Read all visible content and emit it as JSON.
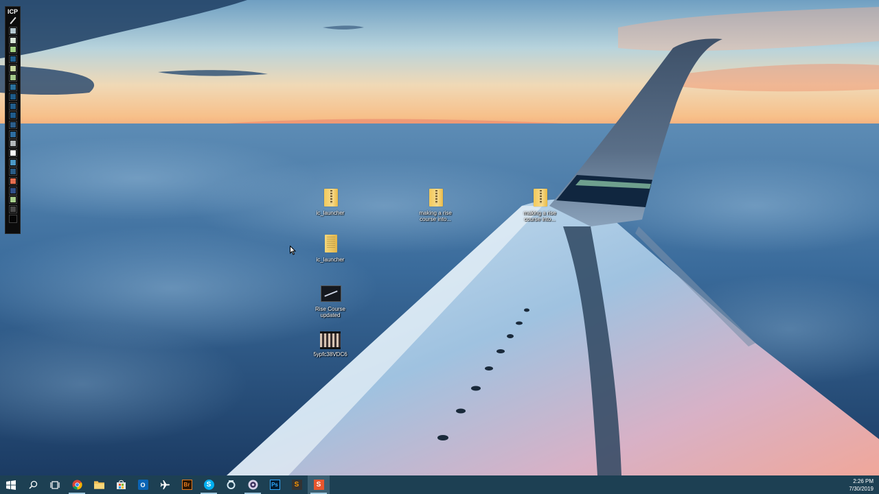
{
  "palette": {
    "title": "ICP",
    "swatches": [
      "#b5c7cf",
      "#d7e3d6",
      "#a3d183",
      "#1f5e8d",
      "#c6d79f",
      "#a4c78a",
      "#2a6f9a",
      "#1e5a87",
      "#205c8a",
      "#1f5b8b",
      "#2b5d89",
      "#2e6da0",
      "#b3b8bb",
      "#fafafa",
      "#4c98c6",
      "#2a5b84",
      "#e36d4f",
      "#304f87",
      "#a6cc8b",
      "#4a4a4a",
      "#050505"
    ]
  },
  "desktop": {
    "icons": [
      {
        "label": "ic_launcher",
        "kind": "zip-folder-icon"
      },
      {
        "label": "making a rise course into...",
        "kind": "zip-folder-icon"
      },
      {
        "label": "making a rise course into...",
        "kind": "zip-folder-icon"
      },
      {
        "label": "ic_launcher",
        "kind": "document-folder-icon"
      },
      {
        "label": "Rise Course updated",
        "kind": "video-file-icon"
      },
      {
        "label": "5ypfc38VDC6",
        "kind": "image-file-icon"
      }
    ]
  },
  "taskbar": {
    "items": [
      {
        "name": "start-button",
        "icon": "windows-logo-icon"
      },
      {
        "name": "search-button",
        "icon": "search-icon"
      },
      {
        "name": "task-view-button",
        "icon": "task-view-icon"
      },
      {
        "name": "chrome-button",
        "icon": "chrome-icon"
      },
      {
        "name": "file-explorer-button",
        "icon": "folder-icon"
      },
      {
        "name": "store-button",
        "icon": "store-icon"
      },
      {
        "name": "outlook-button",
        "icon": "outlook-icon",
        "text": "O"
      },
      {
        "name": "airplane-app-button",
        "icon": "airplane-icon"
      },
      {
        "name": "bridge-button",
        "icon": "bridge-icon",
        "text": "Br"
      },
      {
        "name": "skype-button",
        "icon": "skype-icon",
        "text": "S"
      },
      {
        "name": "app-button",
        "icon": "ring-icon"
      },
      {
        "name": "media-button",
        "icon": "circle-app-icon"
      },
      {
        "name": "photoshop-button",
        "icon": "photoshop-icon",
        "text": "Ps"
      },
      {
        "name": "sublime-button",
        "icon": "sublime-icon",
        "text": "S"
      },
      {
        "name": "storyline-button",
        "icon": "storyline-icon",
        "text": "S"
      }
    ],
    "clock": {
      "time": "2:26 PM",
      "date": "7/30/2019"
    }
  },
  "colors": {
    "taskbar": "#1d4053",
    "accent": "#9ec7dd"
  }
}
